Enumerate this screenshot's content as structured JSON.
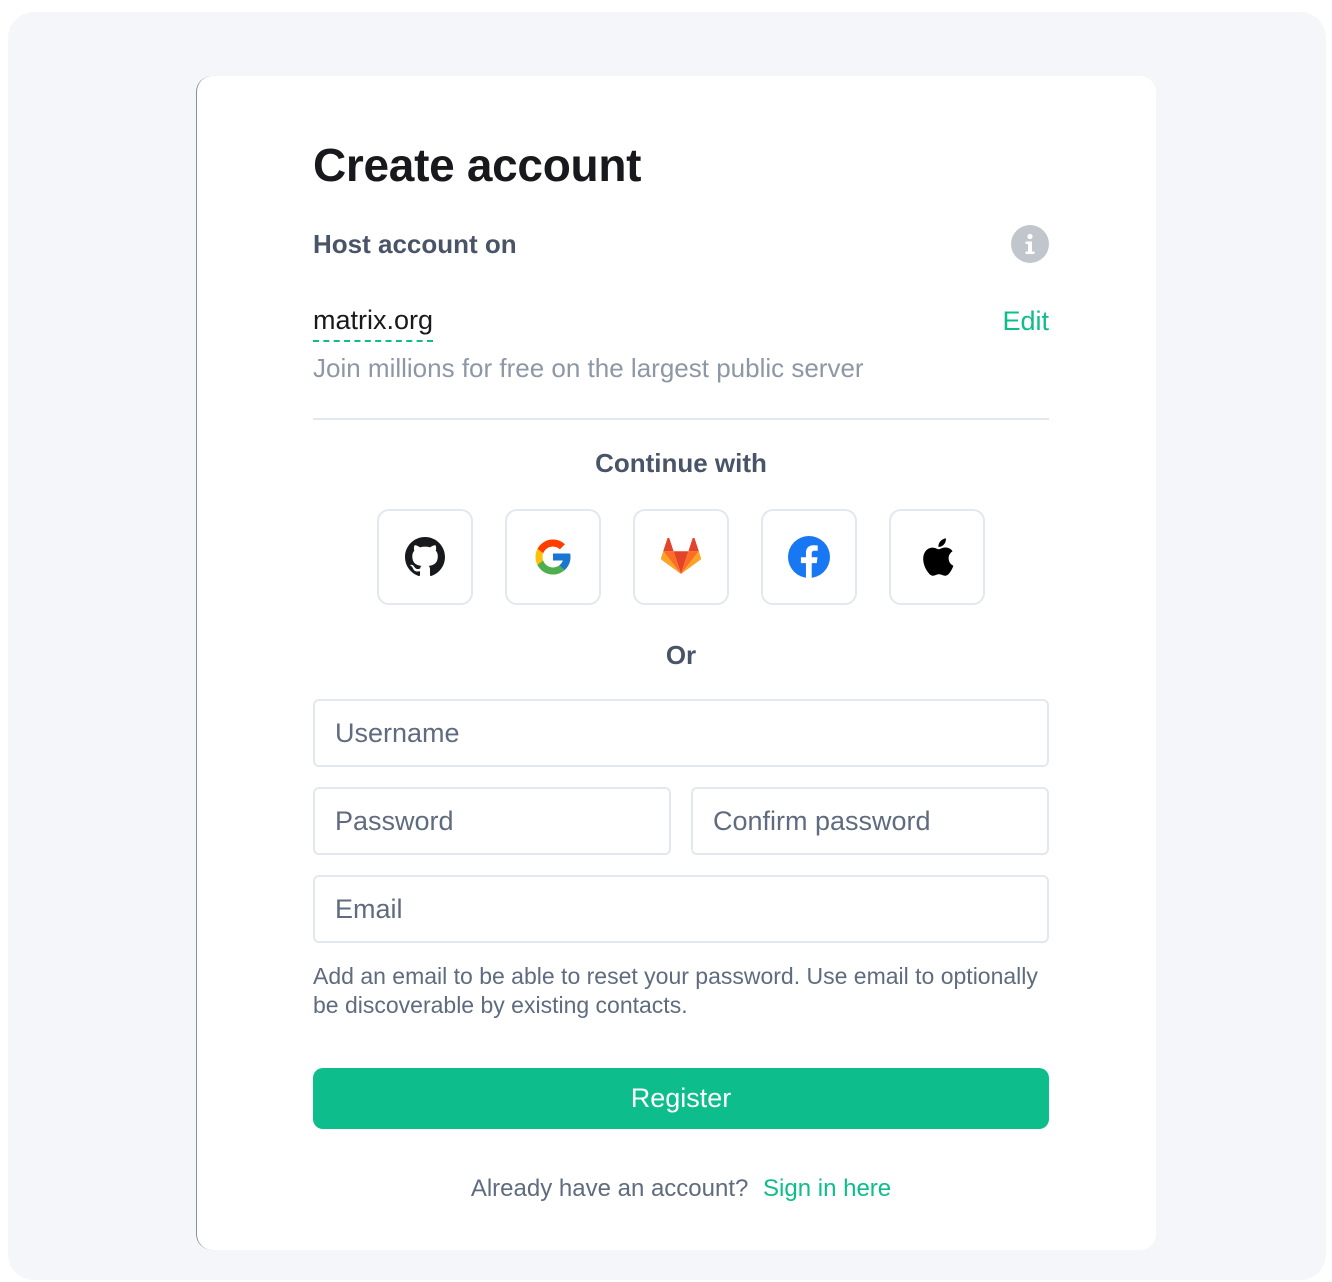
{
  "page": {
    "title": "Create account"
  },
  "host": {
    "label": "Host account on",
    "server_name": "matrix.org",
    "edit_label": "Edit",
    "description": "Join millions for free on the largest public server"
  },
  "sso": {
    "label": "Continue with",
    "providers": [
      {
        "name": "GitHub",
        "icon": "github-icon"
      },
      {
        "name": "Google",
        "icon": "google-icon"
      },
      {
        "name": "GitLab",
        "icon": "gitlab-icon"
      },
      {
        "name": "Facebook",
        "icon": "facebook-icon"
      },
      {
        "name": "Apple",
        "icon": "apple-icon"
      }
    ]
  },
  "separator": {
    "label": "Or"
  },
  "form": {
    "username": {
      "placeholder": "Username",
      "value": ""
    },
    "password": {
      "placeholder": "Password",
      "value": ""
    },
    "confirm_password": {
      "placeholder": "Confirm password",
      "value": ""
    },
    "email": {
      "placeholder": "Email",
      "value": ""
    },
    "email_help": "Add an email to be able to reset your password. Use email to optionally be discoverable by existing contacts.",
    "register_label": "Register"
  },
  "footer": {
    "prompt": "Already have an account?",
    "signin_label": "Sign in here"
  },
  "colors": {
    "accent": "#0dbd8b",
    "heading": "#17191c",
    "secondary_text": "#4a5468",
    "muted_text": "#8d97a5",
    "border": "#e3e8f0",
    "background": "#f4f6fa"
  }
}
